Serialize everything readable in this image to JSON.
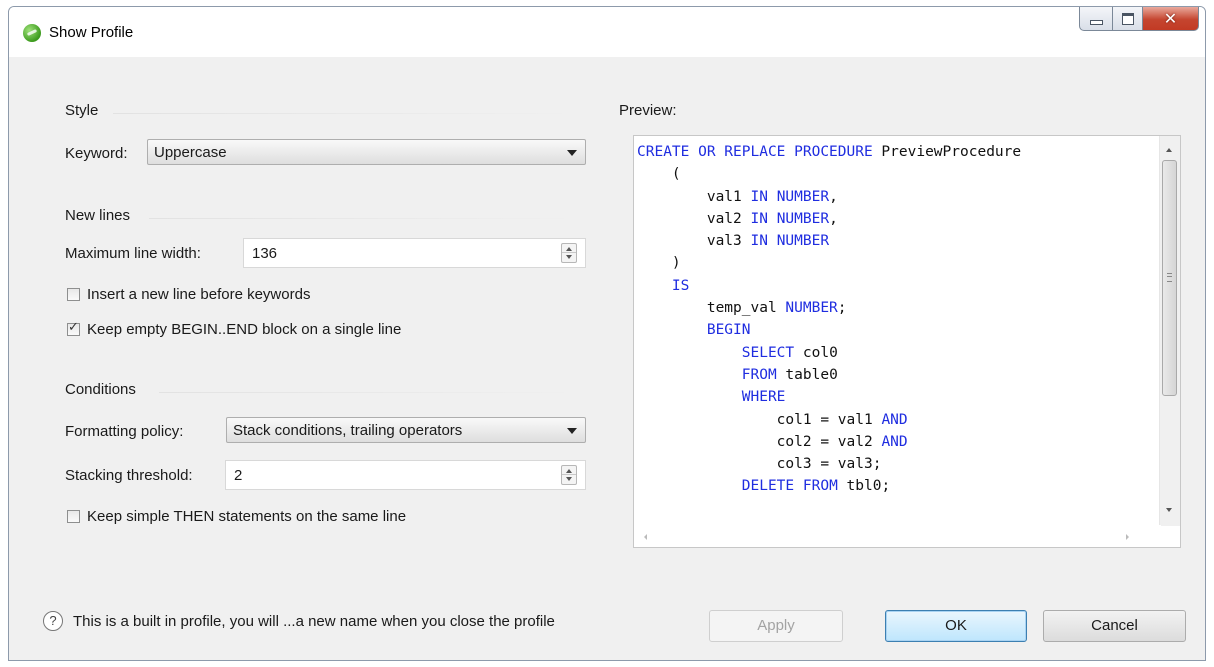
{
  "window": {
    "title": "Show Profile",
    "controls": [
      "minimize-icon",
      "maximize-icon",
      "close-icon"
    ]
  },
  "style_section": {
    "title": "Style",
    "keyword_label": "Keyword:",
    "keyword_value": "Uppercase"
  },
  "newlines_section": {
    "title": "New lines",
    "max_width_label": "Maximum line width:",
    "max_width_value": "136",
    "insert_newline_label": "Insert a new line before keywords",
    "insert_newline_checked": false,
    "keep_empty_label": "Keep empty BEGIN..END block on a single line",
    "keep_empty_checked": true
  },
  "conditions_section": {
    "title": "Conditions",
    "policy_label": "Formatting policy:",
    "policy_value": "Stack conditions, trailing operators",
    "threshold_label": "Stacking threshold:",
    "threshold_value": "2",
    "keep_then_label": "Keep simple THEN statements on the same line",
    "keep_then_checked": false
  },
  "preview": {
    "label": "Preview:",
    "keyword_color": "#1f2de0",
    "lines": [
      [
        {
          "t": "CREATE OR REPLACE PROCEDURE",
          "k": true
        },
        {
          "t": " PreviewProcedure"
        }
      ],
      [
        {
          "t": "    ("
        }
      ],
      [
        {
          "t": "        val1 "
        },
        {
          "t": "IN NUMBER",
          "k": true
        },
        {
          "t": ","
        }
      ],
      [
        {
          "t": "        val2 "
        },
        {
          "t": "IN NUMBER",
          "k": true
        },
        {
          "t": ","
        }
      ],
      [
        {
          "t": "        val3 "
        },
        {
          "t": "IN NUMBER",
          "k": true
        }
      ],
      [
        {
          "t": "    )"
        }
      ],
      [
        {
          "t": "    "
        },
        {
          "t": "IS",
          "k": true
        }
      ],
      [
        {
          "t": "        temp_val "
        },
        {
          "t": "NUMBER",
          "k": true
        },
        {
          "t": ";"
        }
      ],
      [
        {
          "t": "        "
        },
        {
          "t": "BEGIN",
          "k": true
        }
      ],
      [
        {
          "t": "            "
        },
        {
          "t": "SELECT",
          "k": true
        },
        {
          "t": " col0"
        }
      ],
      [
        {
          "t": "            "
        },
        {
          "t": "FROM",
          "k": true
        },
        {
          "t": " table0"
        }
      ],
      [
        {
          "t": "            "
        },
        {
          "t": "WHERE",
          "k": true
        }
      ],
      [
        {
          "t": "                col1 = val1 "
        },
        {
          "t": "AND",
          "k": true
        }
      ],
      [
        {
          "t": "                col2 = val2 "
        },
        {
          "t": "AND",
          "k": true
        }
      ],
      [
        {
          "t": "                col3 = val3;"
        }
      ],
      [
        {
          "t": "            "
        },
        {
          "t": "DELETE FROM",
          "k": true
        },
        {
          "t": " tbl0;"
        }
      ]
    ]
  },
  "footer": {
    "help_icon": "?",
    "message": "This is a built in profile, you will ...a new name when you close the profile",
    "apply_label": "Apply",
    "ok_label": "OK",
    "cancel_label": "Cancel"
  }
}
